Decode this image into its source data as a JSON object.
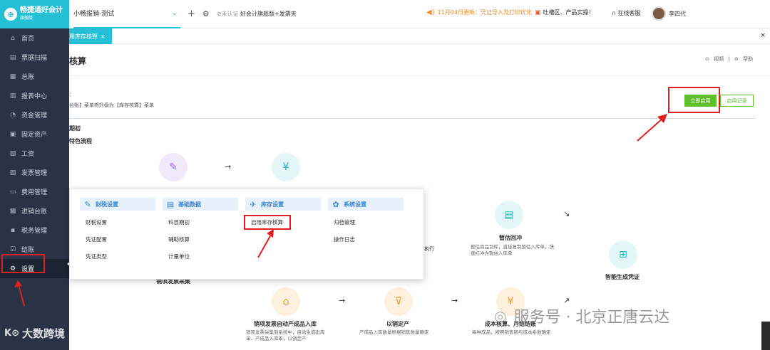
{
  "app": {
    "logo_title": "畅捷通好会计",
    "logo_sub": "旗舰版"
  },
  "sidebar": {
    "items": [
      {
        "label": "首页",
        "icon": "⌂"
      },
      {
        "label": "票据扫描",
        "icon": "▤"
      },
      {
        "label": "总账",
        "icon": "▦"
      },
      {
        "label": "报表中心",
        "icon": "▥"
      },
      {
        "label": "资金管理",
        "icon": "◔"
      },
      {
        "label": "固定资产",
        "icon": "▣"
      },
      {
        "label": "工资",
        "icon": "▧"
      },
      {
        "label": "发票管理",
        "icon": "▨"
      },
      {
        "label": "费用管理",
        "icon": "▭"
      },
      {
        "label": "进销台账",
        "icon": "▩"
      },
      {
        "label": "税务管理",
        "icon": "▪"
      },
      {
        "label": "结账",
        "icon": "☑"
      },
      {
        "label": "设置",
        "icon": "⚙"
      }
    ]
  },
  "topbar": {
    "account_name": "小畅报销-测试",
    "unverified": "未认证",
    "promo": "好会计旗舰版+发票夹",
    "notice": "11月04日更新：凭证导入及打印优化",
    "feedback": "吐槽区、产品实操！",
    "service": "在线客服",
    "user_name": "李四代"
  },
  "tabs": {
    "active_label": "用库存核算",
    "close": "×",
    "close_all": "×"
  },
  "main": {
    "title": "核算",
    "help_video": "视频",
    "help_sep": "|",
    "help_help": "帮助",
    "desc_top": "：",
    "desc": "台账】菜单将升级为【库存核算】菜单",
    "btn_enable": "立即启用",
    "btn_record": "启用记录",
    "section_initial": "期初",
    "section_flow": "特色流程"
  },
  "flow": {
    "node_mid_title": "暂估回冲",
    "node_mid_desc": "暂估商品到库，直接复制暂估入库单，快速红冲为暂估入库单",
    "node_voucher_title": "智能生成凭证",
    "node_bottom1_title": "销项发票自动产成品入库",
    "node_bottom1_desc": "销项发票采集到系统中，自动生成出库单、产成品入库单，以销定产",
    "node_bottom2_title": "以销定产",
    "node_bottom2_desc": "产成品入库数量根据销售数量确定",
    "node_bottom3_title": "成本核算、月结结账",
    "node_bottom3_desc": "每种成品，按照销售额与成本系数确定",
    "partial_left": "销项发票采集",
    "partial_exec": "执行"
  },
  "dropdown": {
    "columns": [
      {
        "title": "财税设置",
        "icon": "✎",
        "items": [
          "财税设置",
          "凭证配置",
          "凭证类型"
        ]
      },
      {
        "title": "基础数据",
        "icon": "▤",
        "items": [
          "科目期初",
          "辅助核算",
          "计量单位"
        ]
      },
      {
        "title": "库存设置",
        "icon": "✈",
        "items": [
          "启用库存核算"
        ]
      },
      {
        "title": "系统设置",
        "icon": "✿",
        "items": [
          "归档管理",
          "操作日志"
        ]
      }
    ]
  },
  "watermarks": {
    "left_logo": "K⊙",
    "left_text": "大数跨境",
    "right_text": "服务号 · 北京正唐云达"
  }
}
